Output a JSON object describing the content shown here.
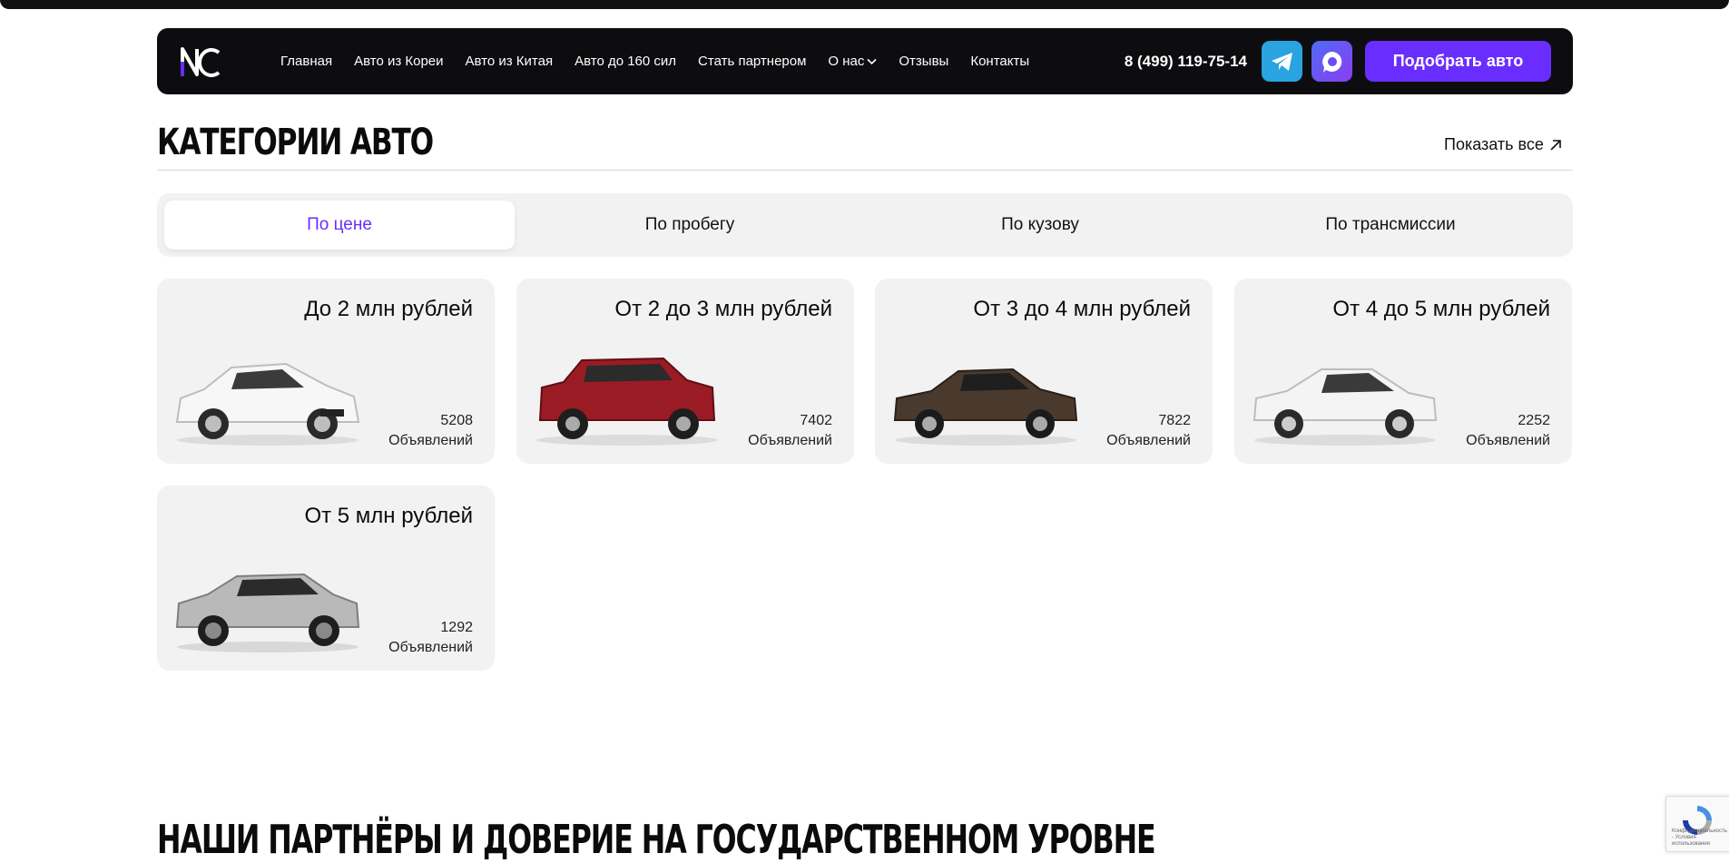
{
  "header": {
    "logo_text": "NC",
    "nav": [
      {
        "label": "Главная"
      },
      {
        "label": "Авто из Кореи"
      },
      {
        "label": "Авто из Китая"
      },
      {
        "label": "Авто до 160 сил"
      },
      {
        "label": "Стать партнером"
      },
      {
        "label": "О нас"
      },
      {
        "label": "Отзывы"
      },
      {
        "label": "Контакты"
      }
    ],
    "phone": "8 (499) 119-75-14",
    "cta_label": "Подобрать авто",
    "social_icons": [
      "telegram-icon",
      "max-messenger-icon"
    ]
  },
  "categories": {
    "title": "КАТЕГОРИИ АВТО",
    "show_all_label": "Показать все",
    "tabs": [
      {
        "label": "По цене",
        "active": true
      },
      {
        "label": "По пробегу",
        "active": false
      },
      {
        "label": "По кузову",
        "active": false
      },
      {
        "label": "По трансмиссии",
        "active": false
      }
    ],
    "cards": [
      {
        "title": "До 2 млн рублей",
        "count": "5208",
        "count_label": "Объявлений",
        "car_color": "#f4f4f4"
      },
      {
        "title": "От 2 до 3 млн рублей",
        "count": "7402",
        "count_label": "Объявлений",
        "car_color": "#9b1b24"
      },
      {
        "title": "От 3 до 4 млн рублей",
        "count": "7822",
        "count_label": "Объявлений",
        "car_color": "#4a3a2e"
      },
      {
        "title": "От 4 до 5 млн рублей",
        "count": "2252",
        "count_label": "Объявлений",
        "car_color": "#f2f2f2"
      },
      {
        "title": "От 5 млн рублей",
        "count": "1292",
        "count_label": "Объявлений",
        "car_color": "#b9b9b9"
      }
    ]
  },
  "partners": {
    "title": "НАШИ ПАРТНЁРЫ И ДОВЕРИЕ НА ГОСУДАРСТВЕННОМ УРОВНЕ"
  },
  "recaptcha": {
    "text": "Конфиденциальность - Условия использования"
  },
  "colors": {
    "accent": "#6a2dff",
    "nav_bg": "#0d0d10",
    "card_bg": "#f2f2f2",
    "telegram": "#2aa3e1"
  }
}
